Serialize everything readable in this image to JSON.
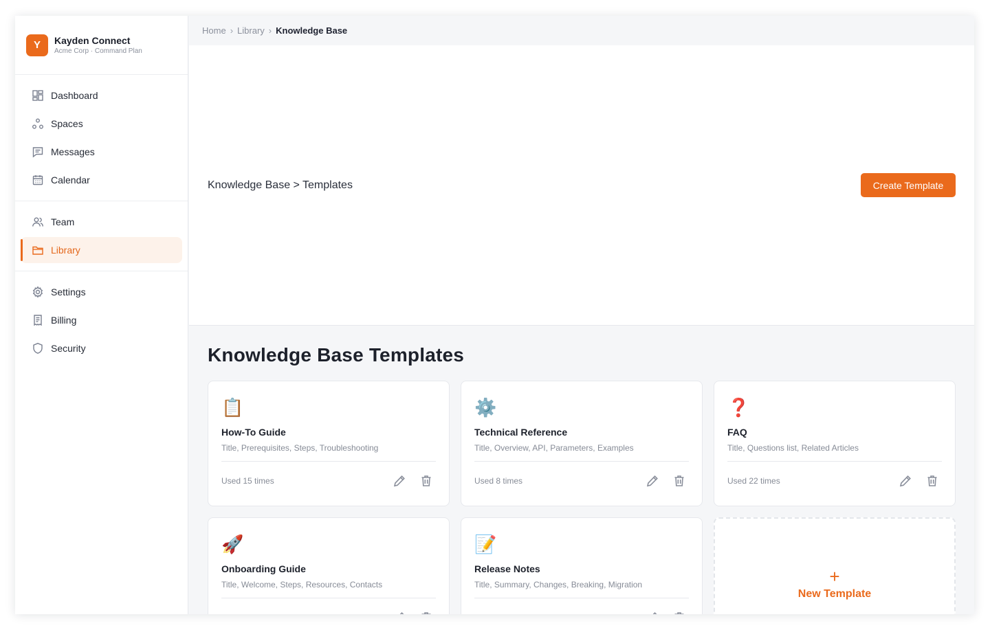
{
  "brand": {
    "initial": "Y",
    "name": "Kayden Connect",
    "subtitle": "Acme Corp · Command Plan"
  },
  "sidebar": {
    "groups": [
      [
        {
          "label": "Dashboard",
          "icon": "dashboard-icon"
        },
        {
          "label": "Spaces",
          "icon": "spaces-icon"
        },
        {
          "label": "Messages",
          "icon": "messages-icon"
        },
        {
          "label": "Calendar",
          "icon": "calendar-icon"
        }
      ],
      [
        {
          "label": "Team",
          "icon": "team-icon"
        },
        {
          "label": "Library",
          "icon": "folder-icon",
          "active": true
        }
      ],
      [
        {
          "label": "Settings",
          "icon": "gear-icon"
        },
        {
          "label": "Billing",
          "icon": "receipt-icon"
        },
        {
          "label": "Security",
          "icon": "shield-icon"
        }
      ]
    ]
  },
  "breadcrumb": {
    "items": [
      "Home",
      "Library"
    ],
    "current": "Knowledge Base",
    "separator": "›"
  },
  "hero": {
    "title": "Knowledge Base > Templates",
    "create_button": "Create Template"
  },
  "page": {
    "title": "Knowledge Base Templates"
  },
  "templates": [
    {
      "emoji": "📋",
      "icon": "clipboard-icon",
      "title": "How-To Guide",
      "fields": "Title, Prerequisites, Steps, Troubleshooting",
      "usage": "Used 15 times"
    },
    {
      "emoji": "⚙️",
      "icon": "gear-icon",
      "title": "Technical Reference",
      "fields": "Title, Overview, API, Parameters, Examples",
      "usage": "Used 8 times"
    },
    {
      "emoji": "❓",
      "icon": "question-icon",
      "title": "FAQ",
      "fields": "Title, Questions list, Related Articles",
      "usage": "Used 22 times"
    },
    {
      "emoji": "🚀",
      "icon": "rocket-icon",
      "title": "Onboarding Guide",
      "fields": "Title, Welcome, Steps, Resources, Contacts",
      "usage": ""
    },
    {
      "emoji": "📝",
      "icon": "memo-icon",
      "title": "Release Notes",
      "fields": "Title, Summary, Changes, Breaking, Migration",
      "usage": ""
    }
  ],
  "new_template": {
    "plus": "+",
    "label": "New Template"
  },
  "colors": {
    "accent": "#ea6a1c",
    "accent_bg": "#fdf2ea"
  }
}
